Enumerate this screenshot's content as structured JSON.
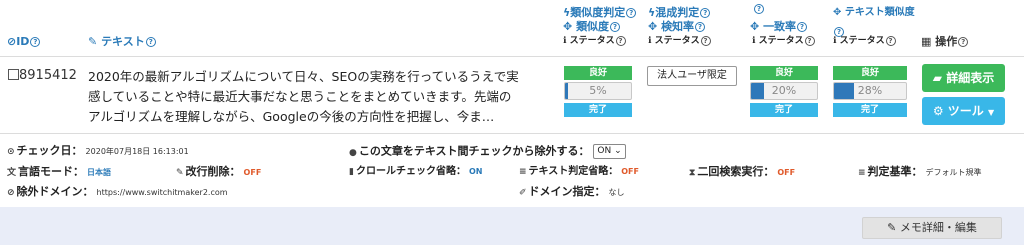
{
  "header": {
    "id_label": "ID",
    "text_label": "テキスト",
    "col1": {
      "line1": "類似度判定",
      "line2": "類似度",
      "status": "ステータス"
    },
    "col2": {
      "line1": "混成判定",
      "line2": "検知率",
      "status": "ステータス"
    },
    "col3": {
      "line2": "一致率",
      "status": "ステータス"
    },
    "col4": {
      "line1": "テキスト類似度",
      "status": "ステータス"
    },
    "ops_label": "操作"
  },
  "row": {
    "id": "8915412",
    "text_line1": "2020年の最新アルゴリズムについて日々、SEOの実務を行っているうえで実",
    "text_line2": "感していることや特に最近大事だなと思うことをまとめていきます。先端の",
    "text_line3": "アルゴリズムを理解しながら、Googleの今後の方向性を把握し、今ま…",
    "col1": {
      "result": "良好",
      "percent": "5%",
      "percent_value": 5,
      "status": "完了"
    },
    "col2": {
      "result": "法人ユーザ限定"
    },
    "col3": {
      "result": "良好",
      "percent": "20%",
      "percent_value": 20,
      "status": "完了"
    },
    "col4": {
      "result": "良好",
      "percent": "28%",
      "percent_value": 28,
      "status": "完了"
    },
    "detail_button": "詳細表示",
    "tool_button": "ツール"
  },
  "meta": {
    "check_date_label": "チェック日：",
    "check_date_value": "2020年07月18日 16:13:01",
    "exclude_label": "この文章をテキスト間チェックから除外する：",
    "exclude_value": "ON",
    "language_label": "言語モード：",
    "language_value": "日本語",
    "line_break_label": "改行削除：",
    "line_break_value": "OFF",
    "crawl_label": "クロールチェック省略：",
    "crawl_value": "ON",
    "text_judge_label": "テキスト判定省略：",
    "text_judge_value": "OFF",
    "second_search_label": "二回検索実行：",
    "second_search_value": "OFF",
    "criteria_label": "判定基準：",
    "criteria_value": "デフォルト規準",
    "exclude_domain_label": "除外ドメイン：",
    "exclude_domain_value": "https://www.switchitmaker2.com",
    "domain_spec_label": "ドメイン指定：",
    "domain_spec_value": "なし"
  },
  "footer": {
    "memo_button": "メモ詳細・編集"
  },
  "colors": {
    "green": "#3cb95a",
    "cyan": "#39b7e8",
    "blue": "#2f78b9",
    "footer_bg": "#e9edf8"
  }
}
